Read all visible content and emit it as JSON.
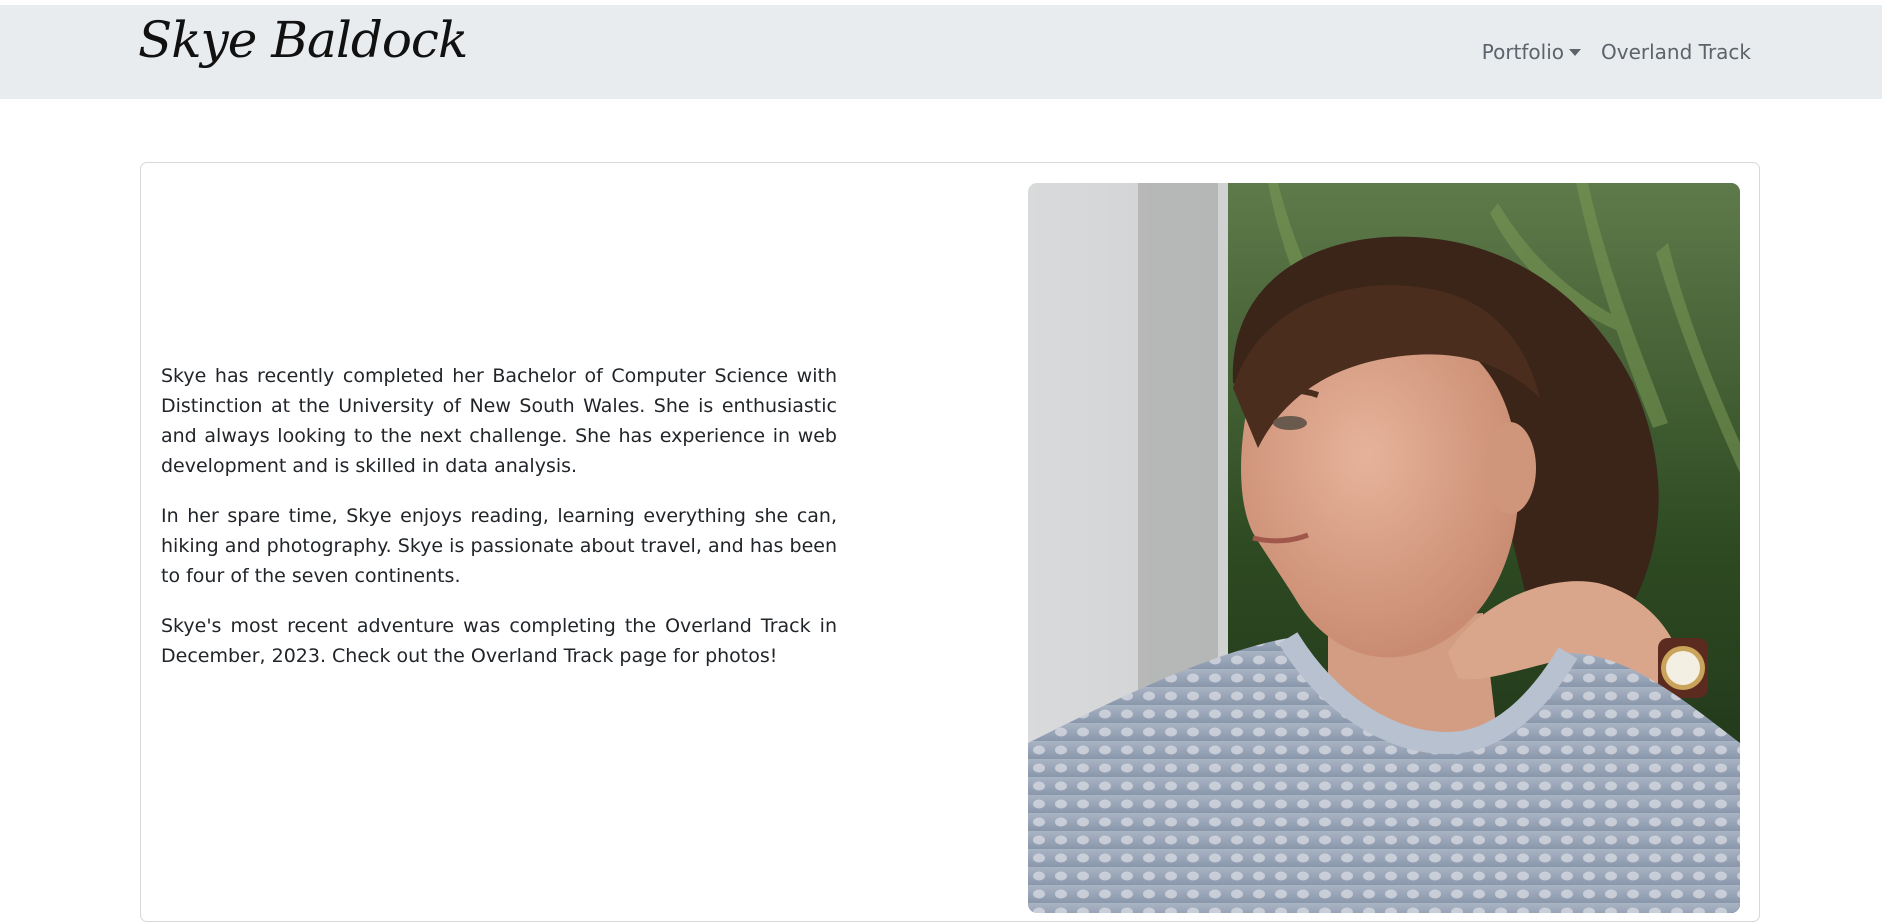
{
  "navbar": {
    "brand": "Skye Baldock",
    "links": [
      {
        "label": "Portfolio",
        "dropdown": true
      },
      {
        "label": "Overland Track",
        "dropdown": false
      }
    ]
  },
  "about": {
    "paragraphs": [
      "Skye has recently completed her Bachelor of Computer Science with Distinction at the University of New South Wales. She is enthusiastic and always looking to the next challenge. She has experience in web development and is skilled in data analysis.",
      "In her spare time, Skye enjoys reading, learning everything she can, hiking and photography. Skye is passionate about travel, and has been to four of the seven continents.",
      "Skye's most recent adventure was completing the Overland Track in December, 2023. Check out the Overland Track page for photos!"
    ]
  },
  "colors": {
    "navbar_bg": "#e9ecef",
    "nav_link": "#5c636a",
    "text": "#212529",
    "card_border": "#d6d8db"
  }
}
